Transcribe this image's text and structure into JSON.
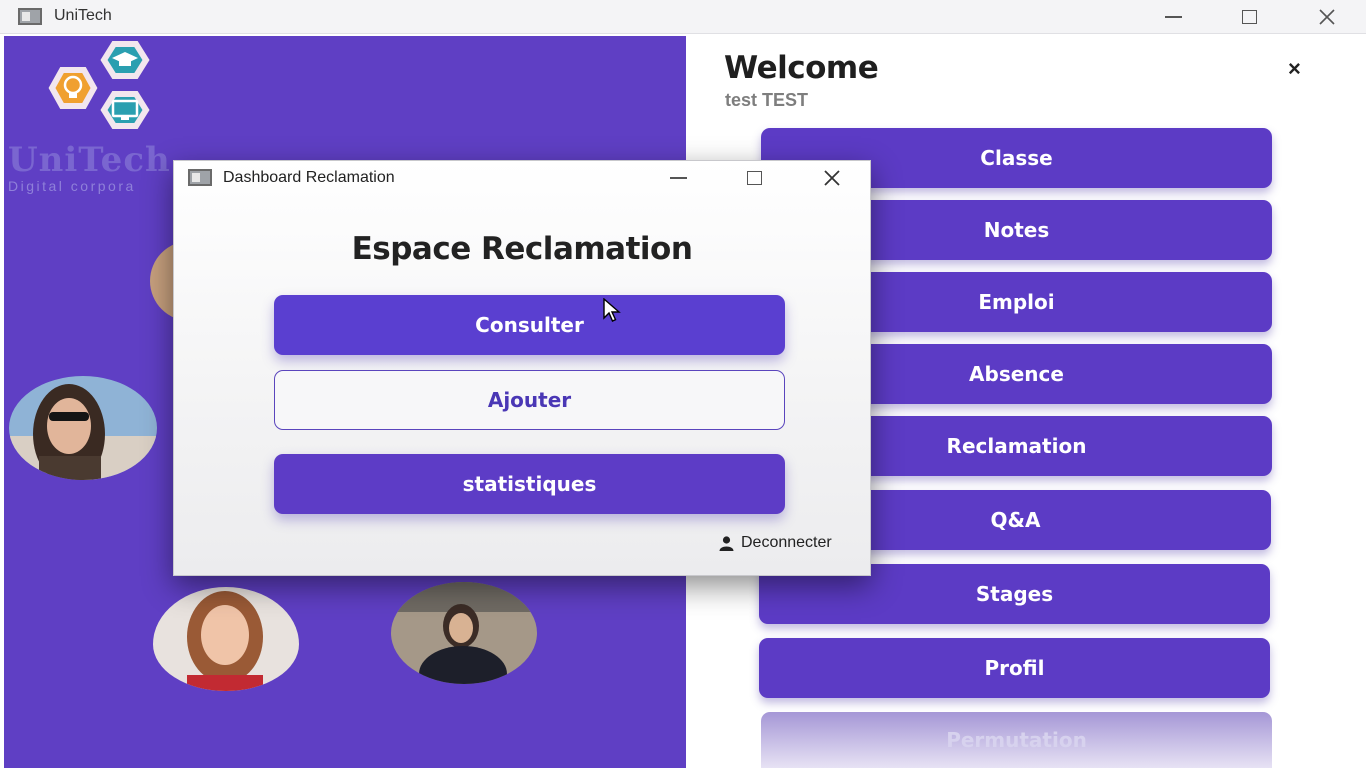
{
  "window": {
    "title": "UniTech"
  },
  "brand": {
    "name": "UniTech",
    "tagline": "Digital corpora"
  },
  "header": {
    "welcome": "Welcome",
    "user": "test TEST",
    "close_label": "×"
  },
  "menu": {
    "items": [
      {
        "label": "Classe"
      },
      {
        "label": "Notes"
      },
      {
        "label": "Emploi"
      },
      {
        "label": "Absence"
      },
      {
        "label": "Reclamation"
      },
      {
        "label": "Q&A"
      },
      {
        "label": "Stages"
      },
      {
        "label": "Profil"
      },
      {
        "label": "Permutation"
      }
    ]
  },
  "dialog": {
    "title": "Dashboard Reclamation",
    "heading": "Espace Reclamation",
    "buttons": {
      "consulter": "Consulter",
      "ajouter": "Ajouter",
      "statistiques": "statistiques"
    },
    "logout": "Deconnecter"
  },
  "colors": {
    "primary": "#5c3bc5",
    "panel": "#5f3fc4",
    "logo_orange": "#f0a030",
    "logo_teal": "#2a9fb0"
  }
}
